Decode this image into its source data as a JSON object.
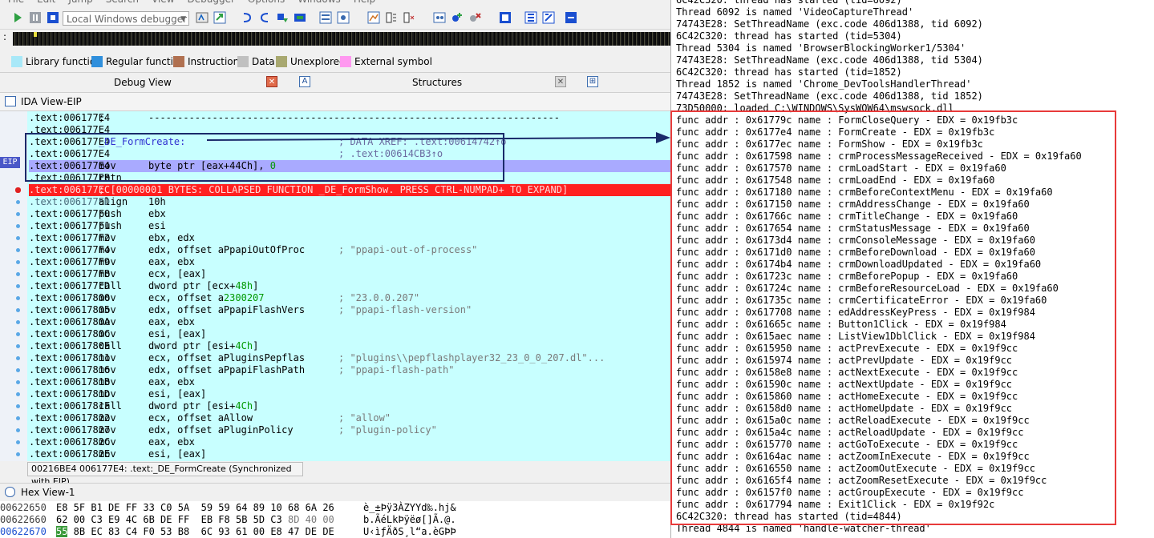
{
  "menu": [
    "File",
    "Edit",
    "Jump",
    "Search",
    "View",
    "Debugger",
    "Options",
    "Windows",
    "Help"
  ],
  "toolbar": {
    "debugger_select": "Local Windows debugger"
  },
  "legend": [
    {
      "label": "Library function",
      "color": "#a8e8f8"
    },
    {
      "label": "Regular function",
      "color": "#2f8fdc"
    },
    {
      "label": "Instruction",
      "color": "#b07050"
    },
    {
      "label": "Data",
      "color": "#c0c0c0"
    },
    {
      "label": "Unexplored",
      "color": "#a8a870"
    },
    {
      "label": "External symbol",
      "color": "#ff98f0"
    }
  ],
  "panes": {
    "debug_view": "Debug View",
    "structures": "Structures",
    "structures_icon": "A"
  },
  "ida_view": {
    "title": "IDA View-EIP",
    "eip_label": "EIP",
    "status": "00216BE4 006177E4: .text:_DE_FormCreate (Synchronized with EIP)",
    "lines": [
      {
        "addr": ".text:006177E4",
        "op": ";",
        "arg": "-----------------------------------------------------------------------",
        "cmt": ""
      },
      {
        "addr": ".text:006177E4",
        "op": "",
        "arg": "",
        "cmt": ""
      },
      {
        "addr": ".text:006177E4",
        "op": "_DE_FormCreate:",
        "arg": "",
        "cmt": "; DATA XREF: .text:00614742↑o"
      },
      {
        "addr": ".text:006177E4",
        "op": "",
        "arg": "",
        "cmt": "; .text:00614CB3↑o"
      },
      {
        "addr": ".text:006177E4",
        "op": "mov",
        "arg": "byte ptr [eax+44Ch], 0",
        "cmt": ""
      },
      {
        "addr": ".text:006177EB",
        "op": "retn",
        "arg": "",
        "cmt": ""
      },
      {
        "addr": ".text:006177EC",
        "op": "; [00000001 BYTES: COLLAPSED FUNCTION _DE_FormShow. PRESS CTRL-NUMPAD+ TO EXPAND]",
        "arg": "",
        "cmt": ""
      },
      {
        "addr": ".text:006177ED",
        "op": "align",
        "arg": "10h",
        "cmt": ""
      },
      {
        "addr": ".text:006177F0",
        "op": "push",
        "arg": "ebx",
        "cmt": ""
      },
      {
        "addr": ".text:006177F1",
        "op": "push",
        "arg": "esi",
        "cmt": ""
      },
      {
        "addr": ".text:006177F2",
        "op": "mov",
        "arg": "ebx, edx",
        "cmt": ""
      },
      {
        "addr": ".text:006177F4",
        "op": "mov",
        "arg": "edx, offset aPpapiOutOfProc",
        "cmt": "; \"ppapi-out-of-process\""
      },
      {
        "addr": ".text:006177F9",
        "op": "mov",
        "arg": "eax, ebx",
        "cmt": ""
      },
      {
        "addr": ".text:006177FB",
        "op": "mov",
        "arg": "ecx, [eax]",
        "cmt": ""
      },
      {
        "addr": ".text:006177FD",
        "op": "call",
        "arg": "dword ptr [ecx+48h]",
        "cmt": ""
      },
      {
        "addr": ".text:00617800",
        "op": "mov",
        "arg": "ecx, offset a2300207",
        "cmt": "; \"23.0.0.207\""
      },
      {
        "addr": ".text:00617805",
        "op": "mov",
        "arg": "edx, offset aPpapiFlashVers",
        "cmt": "; \"ppapi-flash-version\""
      },
      {
        "addr": ".text:0061780A",
        "op": "mov",
        "arg": "eax, ebx",
        "cmt": ""
      },
      {
        "addr": ".text:0061780C",
        "op": "mov",
        "arg": "esi, [eax]",
        "cmt": ""
      },
      {
        "addr": ".text:0061780E",
        "op": "call",
        "arg": "dword ptr [esi+4Ch]",
        "cmt": ""
      },
      {
        "addr": ".text:00617811",
        "op": "mov",
        "arg": "ecx, offset aPluginsPepflas",
        "cmt": "; \"plugins\\\\pepflashplayer32_23_0_0_207.dl\"..."
      },
      {
        "addr": ".text:00617816",
        "op": "mov",
        "arg": "edx, offset aPpapiFlashPath",
        "cmt": "; \"ppapi-flash-path\""
      },
      {
        "addr": ".text:0061781B",
        "op": "mov",
        "arg": "eax, ebx",
        "cmt": ""
      },
      {
        "addr": ".text:0061781D",
        "op": "mov",
        "arg": "esi, [eax]",
        "cmt": ""
      },
      {
        "addr": ".text:0061781F",
        "op": "call",
        "arg": "dword ptr [esi+4Ch]",
        "cmt": ""
      },
      {
        "addr": ".text:00617822",
        "op": "mov",
        "arg": "ecx, offset aAllow",
        "cmt": "; \"allow\""
      },
      {
        "addr": ".text:00617827",
        "op": "mov",
        "arg": "edx, offset aPluginPolicy",
        "cmt": "; \"plugin-policy\""
      },
      {
        "addr": ".text:0061782C",
        "op": "mov",
        "arg": "eax, ebx",
        "cmt": ""
      },
      {
        "addr": ".text:0061782E",
        "op": "mov",
        "arg": "esi, [eax]",
        "cmt": ""
      }
    ]
  },
  "hex_view": {
    "title": "Hex View-1",
    "rows": [
      {
        "addr": "00622650",
        "bytes": "E8 5F B1 DE FF 33 C0 5A  59 59 64 89 10 68 6A 26",
        "ascii": "è_±Þÿ3ÀZYYd‰.hj&"
      },
      {
        "addr": "00622660",
        "bytes": "62 00 C3 E9 4C 6B DE FF  EB F8 5B 5D C3 8D 40 00",
        "ascii": "b.ÃéLkÞÿëø[]Ã.@."
      },
      {
        "addr": "00622670",
        "bytes": "55 8B EC 83 C4 F0 53 B8  6C 93 61 00 E8 47 DE DE",
        "ascii": "U‹ìƒÄðS¸l“a.èGÞÞ"
      }
    ]
  },
  "output_log": [
    "6C42C320: thread has started (tid=6092)",
    "Thread 6092 is named 'VideoCaptureThread'",
    "74743E28: SetThreadName (exc.code 406d1388, tid 6092)",
    "6C42C320: thread has started (tid=5304)",
    "Thread 5304 is named 'BrowserBlockingWorker1/5304'",
    "74743E28: SetThreadName (exc.code 406d1388, tid 5304)",
    "6C42C320: thread has started (tid=1852)",
    "Thread 1852 is named 'Chrome_DevToolsHandlerThread'",
    "74743E28: SetThreadName (exc.code 406d1388, tid 1852)",
    "73D50000: loaded C:\\WINDOWS\\SysWOW64\\mswsock.dll",
    "func addr : 0x61779c name : FormCloseQuery - EDX = 0x19fb3c",
    "func addr : 0x6177e4 name : FormCreate - EDX = 0x19fb3c",
    "func addr : 0x6177ec name : FormShow - EDX = 0x19fb3c",
    "func addr : 0x617598 name : crmProcessMessageReceived - EDX = 0x19fa60",
    "func addr : 0x617570 name : crmLoadStart - EDX = 0x19fa60",
    "func addr : 0x617548 name : crmLoadEnd - EDX = 0x19fa60",
    "func addr : 0x617180 name : crmBeforeContextMenu - EDX = 0x19fa60",
    "func addr : 0x617150 name : crmAddressChange - EDX = 0x19fa60",
    "func addr : 0x61766c name : crmTitleChange - EDX = 0x19fa60",
    "func addr : 0x617654 name : crmStatusMessage - EDX = 0x19fa60",
    "func addr : 0x6173d4 name : crmConsoleMessage - EDX = 0x19fa60",
    "func addr : 0x6171d0 name : crmBeforeDownload - EDX = 0x19fa60",
    "func addr : 0x6174b4 name : crmDownloadUpdated - EDX = 0x19fa60",
    "func addr : 0x61723c name : crmBeforePopup - EDX = 0x19fa60",
    "func addr : 0x61724c name : crmBeforeResourceLoad - EDX = 0x19fa60",
    "func addr : 0x61735c name : crmCertificateError - EDX = 0x19fa60",
    "func addr : 0x617708 name : edAddressKeyPress - EDX = 0x19f984",
    "func addr : 0x61665c name : Button1Click - EDX = 0x19f984",
    "func addr : 0x615aec name : ListView1DblClick - EDX = 0x19f984",
    "func addr : 0x615950 name : actPrevExecute - EDX = 0x19f9cc",
    "func addr : 0x615974 name : actPrevUpdate - EDX = 0x19f9cc",
    "func addr : 0x6158e8 name : actNextExecute - EDX = 0x19f9cc",
    "func addr : 0x61590c name : actNextUpdate - EDX = 0x19f9cc",
    "func addr : 0x615860 name : actHomeExecute - EDX = 0x19f9cc",
    "func addr : 0x6158d0 name : actHomeUpdate - EDX = 0x19f9cc",
    "func addr : 0x615a0c name : actReloadExecute - EDX = 0x19f9cc",
    "func addr : 0x615a4c name : actReloadUpdate - EDX = 0x19f9cc",
    "func addr : 0x615770 name : actGoToExecute - EDX = 0x19f9cc",
    "func addr : 0x6164ac name : actZoomInExecute - EDX = 0x19f9cc",
    "func addr : 0x616550 name : actZoomOutExecute - EDX = 0x19f9cc",
    "func addr : 0x6165f4 name : actZoomResetExecute - EDX = 0x19f9cc",
    "func addr : 0x6157f0 name : actGroupExecute - EDX = 0x19f9cc",
    "func addr : 0x617794 name : Exit1Click - EDX = 0x19f92c",
    "6C42C320: thread has started (tid=4844)",
    "Thread 4844 is named 'handle-watcher-thread'"
  ]
}
